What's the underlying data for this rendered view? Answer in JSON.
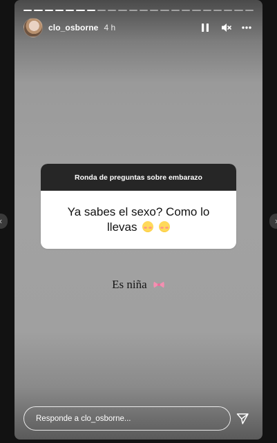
{
  "story": {
    "progress_total": 22,
    "progress_done": 7
  },
  "header": {
    "username": "clo_osborne",
    "time": "4 h",
    "icons": [
      "pause-icon",
      "mute-icon",
      "more-icon"
    ],
    "avatar_icon": "avatar"
  },
  "question": {
    "title": "Ronda de preguntas sobre embarazo",
    "text": "Ya sabes el sexo? Como lo llevas",
    "emojis": [
      "smiling-blush-emoji",
      "kissing-emoji"
    ]
  },
  "caption": {
    "text": "Es niña",
    "emoji": "pink-bow-emoji"
  },
  "reply": {
    "placeholder": "Responde a clo_osborne...",
    "send_icon": "send-icon"
  },
  "colors": {
    "sticker_header": "#262626",
    "background": "#121212"
  }
}
